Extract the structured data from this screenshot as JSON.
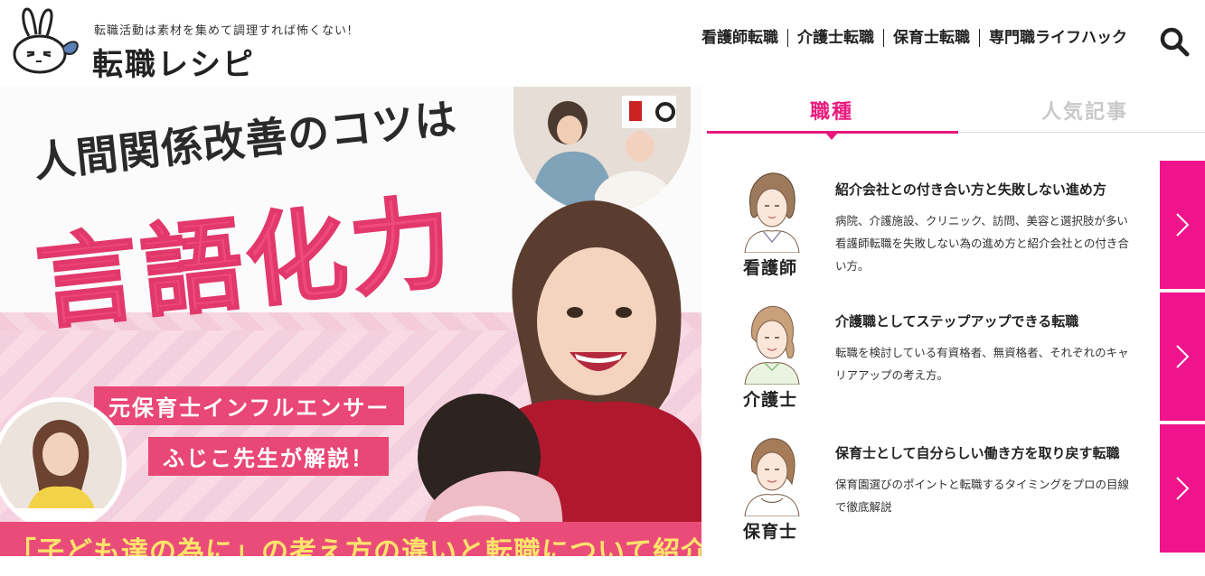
{
  "header": {
    "tagline": "転職活動は素材を集めて調理すれば怖くない!",
    "site_title": "転職レシピ",
    "nav": [
      {
        "label": "看護師転職"
      },
      {
        "label": "介護士転職"
      },
      {
        "label": "保育士転職"
      },
      {
        "label": "専門職ライフハック"
      }
    ],
    "search_icon": "search-icon"
  },
  "hero": {
    "headline_small": "人間関係改善のコツは",
    "headline_big": "言語化力",
    "tag1": "元保育士インフルエンサー",
    "tag2": "ふじこ先生が解説！",
    "bottom_text": "「子ども達の為に」の考え方の違いと転職について紹介"
  },
  "sidebar": {
    "tabs": [
      {
        "label": "職種",
        "active": true
      },
      {
        "label": "人気記事",
        "active": false
      }
    ],
    "cards": [
      {
        "role": "看護師",
        "title": "紹介会社との付き合い方と失敗しない進め方",
        "desc": "病院、介護施設、クリニック、訪問、美容と選択肢が多い看護師転職を失敗しない為の進め方と紹介会社との付き合い方。",
        "icon": "chevron-right-icon"
      },
      {
        "role": "介護士",
        "title": "介護職としてステップアップできる転職",
        "desc": "転職を検討している有資格者、無資格者、それぞれのキャリアアップの考え方。",
        "icon": "chevron-right-icon"
      },
      {
        "role": "保育士",
        "title": "保育士として自分らしい働き方を取り戻す転職",
        "desc": "保育園選びのポイントと転職するタイミングをプロの目線で徹底解説",
        "icon": "chevron-right-icon"
      }
    ]
  },
  "colors": {
    "accent": "#e8197d",
    "hero_pink": "#ee4a7b",
    "arrow_bg": "#f0148c",
    "banner_text": "#ffe36b"
  }
}
